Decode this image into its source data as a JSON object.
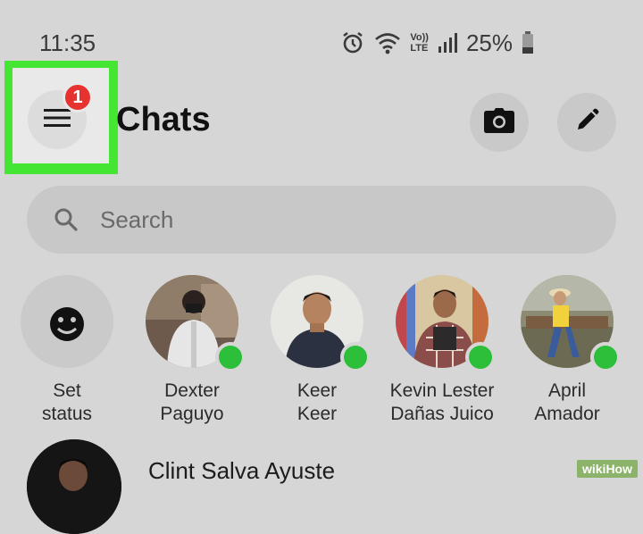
{
  "status_bar": {
    "time": "11:35",
    "network_label_top": "Vo))",
    "network_label_bottom": "LTE",
    "battery": "25%",
    "icons": [
      "alarm-icon",
      "wifi-icon",
      "volte-lte-icon",
      "signal-icon",
      "battery-icon"
    ]
  },
  "header": {
    "title": "Chats",
    "menu_badge": "1",
    "camera_icon": "camera-icon",
    "edit_icon": "pencil-icon"
  },
  "search": {
    "placeholder": "Search"
  },
  "stories": [
    {
      "line1": "Set",
      "line2": "status",
      "online": false
    },
    {
      "line1": "Dexter",
      "line2": "Paguyo",
      "online": true
    },
    {
      "line1": "Keer",
      "line2": "Keer",
      "online": true
    },
    {
      "line1": "Kevin Lester",
      "line2": "Dañas Juico",
      "online": true
    },
    {
      "line1": "April",
      "line2": "Amador",
      "online": true
    }
  ],
  "chats": [
    {
      "name": "Clint Salva Ayuste"
    }
  ],
  "watermark": "wikiHow",
  "colors": {
    "highlight": "#44e633",
    "badge": "#e7332f",
    "online": "#2dbf3a",
    "background": "#d6d6d6"
  }
}
